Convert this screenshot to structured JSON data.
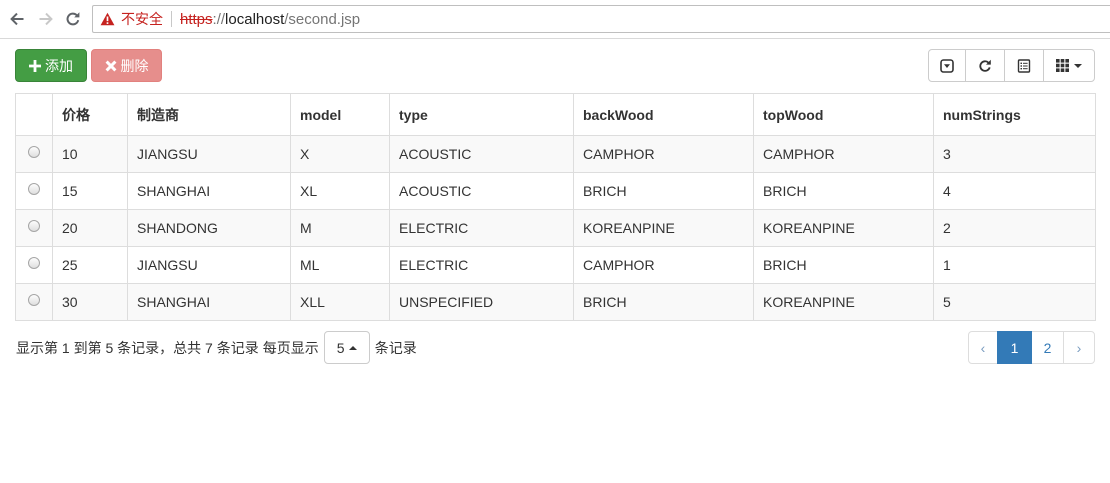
{
  "browser": {
    "nav": {
      "back_icon": "arrow-left-icon",
      "forward_icon": "arrow-right-icon",
      "reload_icon": "reload-icon"
    },
    "address_bar": {
      "security_icon": "warning-triangle-icon",
      "security_label": "不安全",
      "url_scheme": "https",
      "url_separator": "://",
      "url_host": "localhost",
      "url_path": "/second.jsp"
    }
  },
  "toolbar": {
    "add_icon": "plus-icon",
    "add_label": "添加",
    "delete_icon": "remove-icon",
    "delete_label": "删除",
    "view_buttons": [
      {
        "icon": "collapse-down-icon"
      },
      {
        "icon": "refresh-icon"
      },
      {
        "icon": "list-alt-icon"
      },
      {
        "icon": "grid-icon",
        "has_caret": true
      }
    ]
  },
  "table": {
    "columns": [
      "价格",
      "制造商",
      "model",
      "type",
      "backWood",
      "topWood",
      "numStrings"
    ],
    "rows": [
      {
        "price": 10,
        "manufacturer": "JIANGSU",
        "model": "X",
        "type": "ACOUSTIC",
        "backWood": "CAMPHOR",
        "topWood": "CAMPHOR",
        "numStrings": 3
      },
      {
        "price": 15,
        "manufacturer": "SHANGHAI",
        "model": "XL",
        "type": "ACOUSTIC",
        "backWood": "BRICH",
        "topWood": "BRICH",
        "numStrings": 4
      },
      {
        "price": 20,
        "manufacturer": "SHANDONG",
        "model": "M",
        "type": "ELECTRIC",
        "backWood": "KOREANPINE",
        "topWood": "KOREANPINE",
        "numStrings": 2
      },
      {
        "price": 25,
        "manufacturer": "JIANGSU",
        "model": "ML",
        "type": "ELECTRIC",
        "backWood": "CAMPHOR",
        "topWood": "BRICH",
        "numStrings": 1
      },
      {
        "price": 30,
        "manufacturer": "SHANGHAI",
        "model": "XLL",
        "type": "UNSPECIFIED",
        "backWood": "BRICH",
        "topWood": "KOREANPINE",
        "numStrings": 5
      }
    ]
  },
  "pagination": {
    "range_text": "显示第 1 到第 5 条记录，总共 7 条记录",
    "page_size_prefix": "每页显示",
    "page_size": "5",
    "page_size_suffix": "条记录",
    "prev_label": "‹",
    "next_label": "›",
    "pages": [
      {
        "label": "1",
        "active": true
      },
      {
        "label": "2",
        "active": false
      }
    ]
  },
  "colors": {
    "success": "#449d44",
    "danger": "#d9534f",
    "primary": "#337ab7",
    "insecure": "#c5221f",
    "table_border": "#dddddd",
    "row_stripe": "#f9f9f9"
  }
}
